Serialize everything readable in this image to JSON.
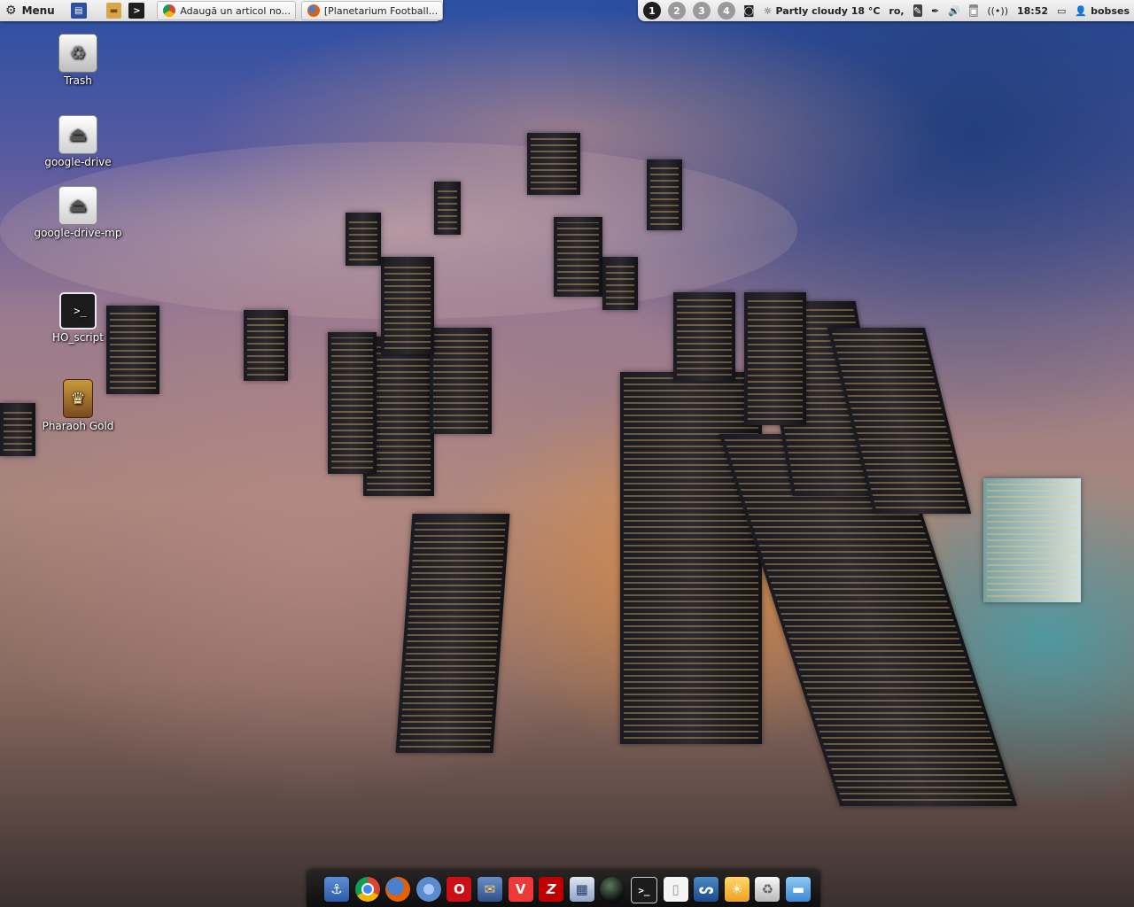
{
  "top_panel": {
    "menu_label": "Menu",
    "tasks": [
      {
        "title": "Adaugă un articol no...",
        "icon": "chrome-icon"
      },
      {
        "title": "[Planetarium Football...",
        "icon": "firefox-icon"
      }
    ],
    "workspaces": [
      "1",
      "2",
      "3",
      "4"
    ],
    "active_workspace": "1",
    "weather": "Partly cloudy 18 °C",
    "keyboard_layout": "ro,",
    "clock": "18:52",
    "user": "bobses"
  },
  "desktop": {
    "icons": [
      {
        "label": "Trash",
        "type": "trash-icon"
      },
      {
        "label": "google-drive",
        "type": "drive-icon"
      },
      {
        "label": "google-drive-mp",
        "type": "drive-icon"
      },
      {
        "label": "HO_script",
        "type": "terminal-icon"
      },
      {
        "label": "Pharaoh Gold",
        "type": "game-icon"
      }
    ]
  },
  "dock": {
    "items": [
      "anchor-icon",
      "chrome-icon",
      "firefox-icon",
      "chromium-icon",
      "opera-icon",
      "thunderbird-icon",
      "vivaldi-icon",
      "filezilla-icon",
      "save-icon",
      "globe-icon",
      "terminal-icon",
      "document-icon",
      "steam-icon",
      "weather-icon",
      "trash-icon",
      "monitor-icon"
    ]
  },
  "colors": {
    "panel_bg": "#e8e8e8",
    "workspace_active": "#1e1e1e",
    "workspace_inactive": "#9a9a9a"
  }
}
